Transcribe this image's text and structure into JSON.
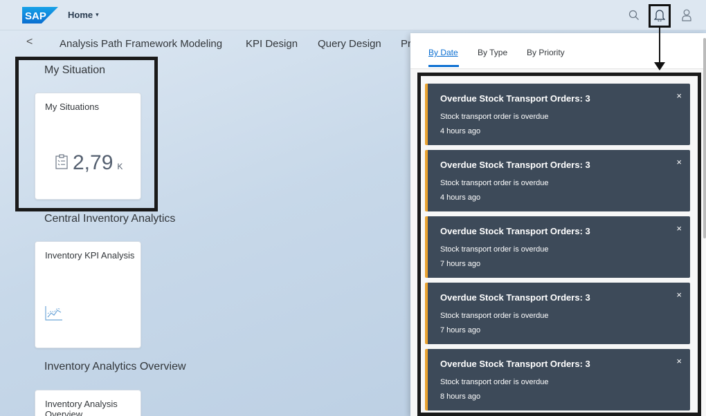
{
  "header": {
    "logo_text": "SAP",
    "home_label": "Home",
    "home_caret": "▾",
    "icons": [
      "search-icon",
      "bell-icon",
      "user-icon"
    ]
  },
  "tabs": {
    "back": "<",
    "items": [
      "Analysis Path Framework Modeling",
      "KPI Design",
      "Query Design",
      "Pr"
    ]
  },
  "sections": [
    {
      "title": "My Situation"
    },
    {
      "title": "Central Inventory Analytics"
    },
    {
      "title": "Inventory Analytics Overview"
    }
  ],
  "tiles": {
    "my_situations": {
      "title": "My Situations",
      "value": "2,79",
      "unit": "K",
      "icon": "clipboard-icon"
    },
    "inventory_kpi": {
      "title": "Inventory KPI Analysis",
      "icon": "line-chart-icon"
    },
    "inventory_overview": {
      "title": "Inventory Analysis Overview"
    }
  },
  "notifications": {
    "tabs": [
      "By Date",
      "By Type",
      "By Priority"
    ],
    "active_tab": "By Date",
    "items": [
      {
        "title": "Overdue Stock Transport Orders: 3",
        "desc": "Stock transport order is overdue",
        "time": "4 hours ago"
      },
      {
        "title": "Overdue Stock Transport Orders: 3",
        "desc": "Stock transport order is overdue",
        "time": "4 hours ago"
      },
      {
        "title": "Overdue Stock Transport Orders: 3",
        "desc": "Stock transport order is overdue",
        "time": "7 hours ago"
      },
      {
        "title": "Overdue Stock Transport Orders: 3",
        "desc": "Stock transport order is overdue",
        "time": "7 hours ago"
      },
      {
        "title": "Overdue Stock Transport Orders: 3",
        "desc": "Stock transport order is overdue",
        "time": "8 hours ago"
      }
    ],
    "close_glyph": "×"
  },
  "colors": {
    "accent": "#0a6ed1",
    "notification_bg": "#3d4a59",
    "notification_stripe": "#e9a230",
    "sap_blue": "#0a6ed1"
  }
}
